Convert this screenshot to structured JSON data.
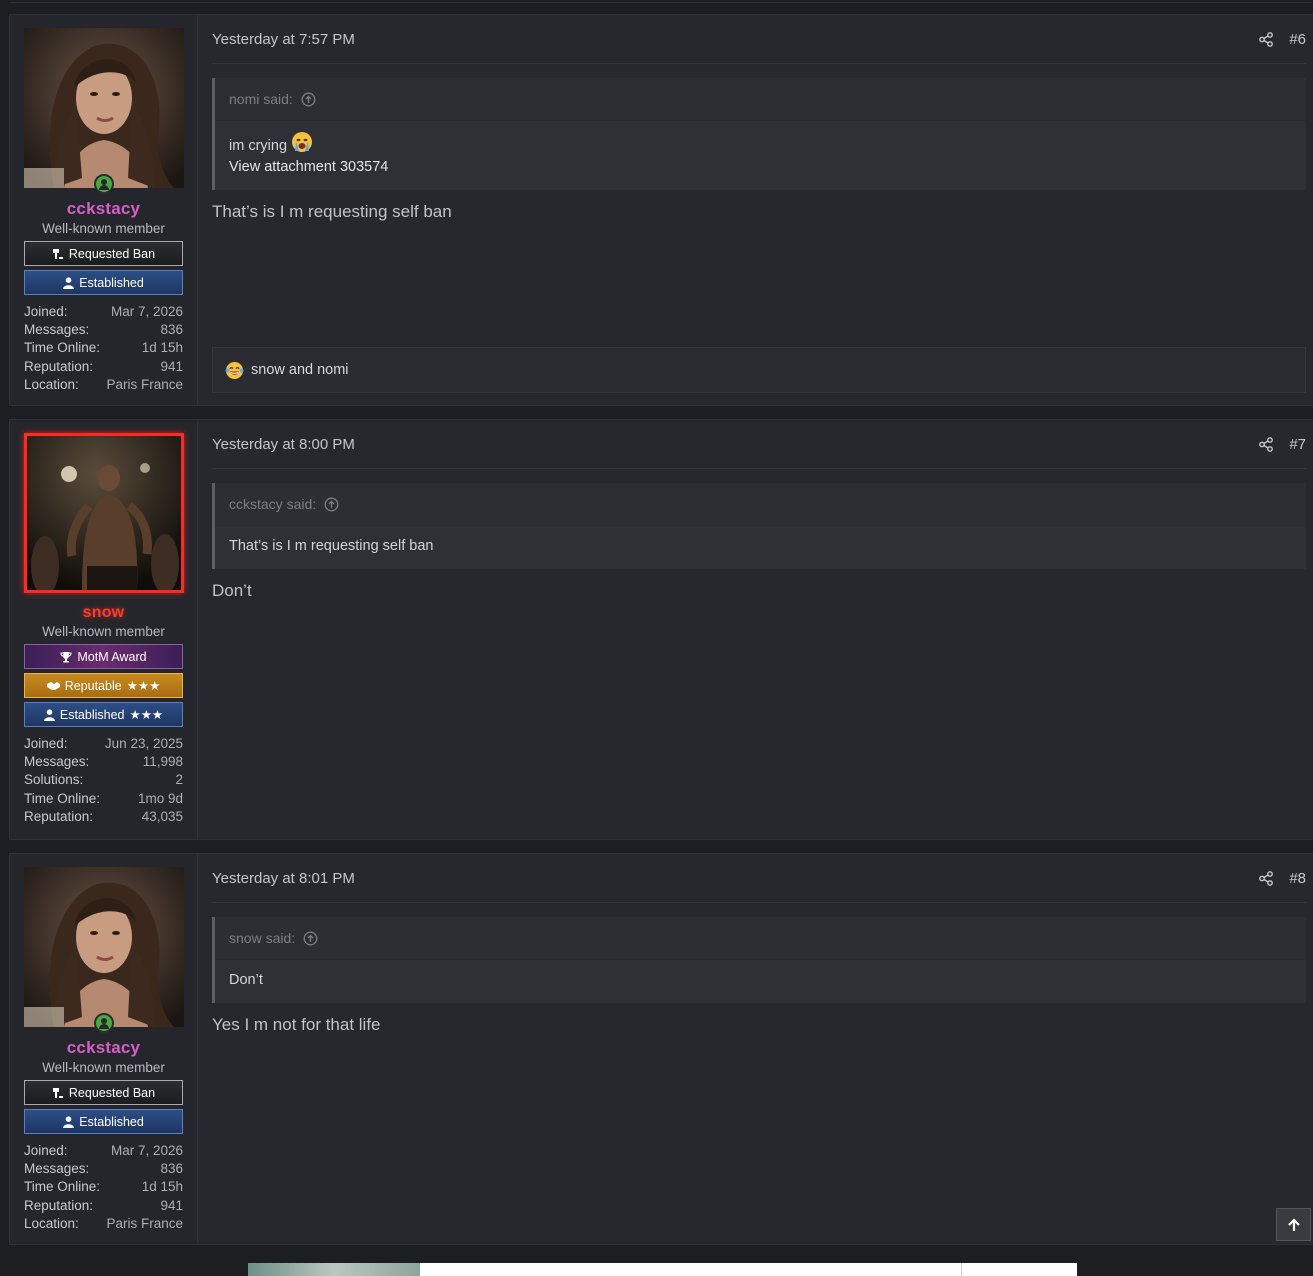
{
  "posts": [
    {
      "user": {
        "name": "cckstacy",
        "title": "Well-known member",
        "banners": [
          "Requested Ban",
          "Established"
        ],
        "stats": [
          {
            "k": "Joined:",
            "v": "Mar 7, 2026"
          },
          {
            "k": "Messages:",
            "v": "836"
          },
          {
            "k": "Time Online:",
            "v": "1d 15h"
          },
          {
            "k": "Reputation:",
            "v": "941"
          },
          {
            "k": "Location:",
            "v": "Paris France"
          }
        ]
      },
      "time": "Yesterday at 7:57 PM",
      "number": "#6",
      "quote": {
        "author": "nomi said:",
        "line1": "im crying",
        "line2": "View attachment 303574"
      },
      "text": "That’s is I m requesting self ban",
      "reactions": "snow and nomi"
    },
    {
      "user": {
        "name": "snow",
        "title": "Well-known member",
        "banners": [
          "MotM Award",
          "Reputable",
          "Established"
        ],
        "stars": "★★★",
        "stats": [
          {
            "k": "Joined:",
            "v": "Jun 23, 2025"
          },
          {
            "k": "Messages:",
            "v": "11,998"
          },
          {
            "k": "Solutions:",
            "v": "2"
          },
          {
            "k": "Time Online:",
            "v": "1mo 9d"
          },
          {
            "k": "Reputation:",
            "v": "43,035"
          }
        ]
      },
      "time": "Yesterday at 8:00 PM",
      "number": "#7",
      "quote": {
        "author": "cckstacy said:",
        "line1": "That’s is I m requesting self ban"
      },
      "text": "Don’t"
    },
    {
      "user": {
        "name": "cckstacy",
        "title": "Well-known member",
        "banners": [
          "Requested Ban",
          "Established"
        ],
        "stats": [
          {
            "k": "Joined:",
            "v": "Mar 7, 2026"
          },
          {
            "k": "Messages:",
            "v": "836"
          },
          {
            "k": "Time Online:",
            "v": "1d 15h"
          },
          {
            "k": "Reputation:",
            "v": "941"
          },
          {
            "k": "Location:",
            "v": "Paris France"
          }
        ]
      },
      "time": "Yesterday at 8:01 PM",
      "number": "#8",
      "quote": {
        "author": "snow said:",
        "line1": "Don’t"
      },
      "text": "Yes I m not for that life"
    }
  ],
  "icons": {
    "share": "share-icon",
    "quote_jump": "arrow-up-circle-icon",
    "online": "online-user-icon",
    "ban": "gavel-icon",
    "user": "user-icon",
    "trophy": "trophy-icon",
    "handshake": "handshake-icon",
    "scroll_top": "arrow-up-icon",
    "crying_emoji": "crying-face-icon",
    "reaction_emoji": "laughing-tears-icon"
  },
  "colors": {
    "username_pink": "#d45fc9",
    "username_red": "#ff3b30",
    "online_green": "#4aa93f",
    "established_blue": "#2d4e86",
    "reputable_gold": "#c98a1e",
    "motm_purple": "#6a2b6e"
  }
}
